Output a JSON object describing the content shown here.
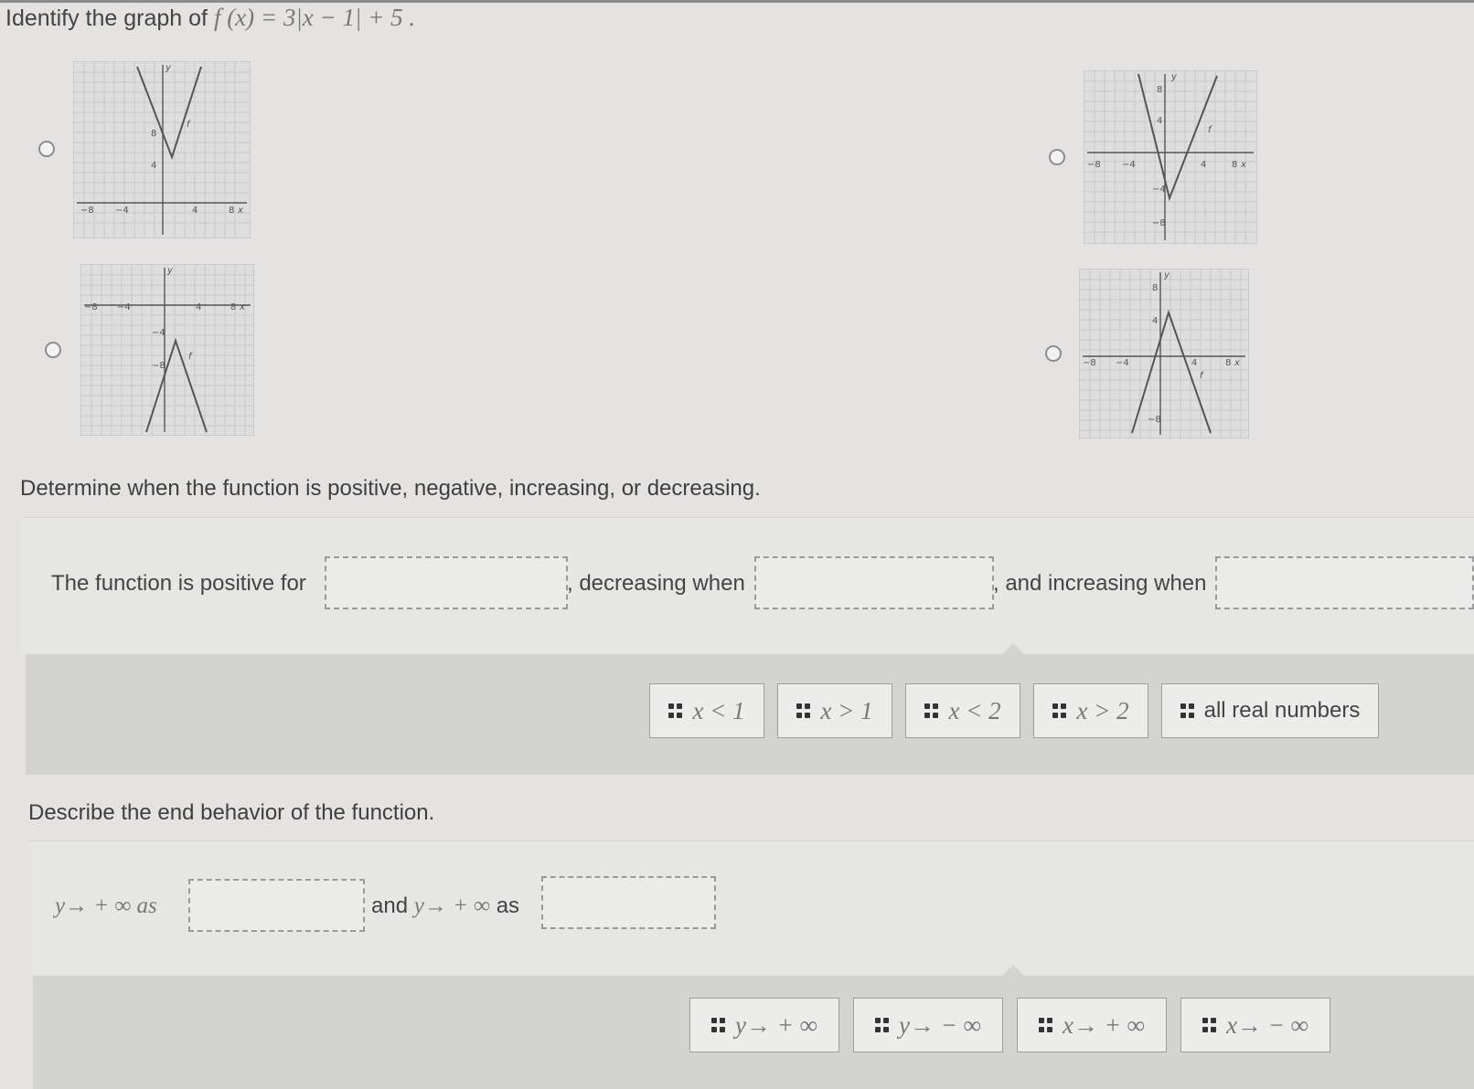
{
  "question": {
    "prefix": "Identify the graph of",
    "formula": "f (x) = 3|x − 1| + 5 ."
  },
  "graphs": [
    {
      "x_ticks": [
        "−8",
        "−4",
        "4",
        "8"
      ],
      "y_ticks": [
        "8",
        "4"
      ],
      "axis_x": "x",
      "axis_y": "y",
      "curve": "f"
    },
    {
      "x_ticks": [
        "−8",
        "−4",
        "4",
        "8"
      ],
      "y_ticks": [
        "8",
        "4",
        "−4",
        "−8"
      ],
      "axis_x": "x",
      "axis_y": "y",
      "curve": "f"
    },
    {
      "x_ticks": [
        "−8",
        "−4",
        "4",
        "8"
      ],
      "y_ticks": [
        "−4",
        "−8"
      ],
      "axis_x": "x",
      "axis_y": "y",
      "curve": "f"
    },
    {
      "x_ticks": [
        "−8",
        "−4",
        "4",
        "8"
      ],
      "y_ticks": [
        "8",
        "4",
        "−8"
      ],
      "axis_x": "x",
      "axis_y": "y",
      "curve": "f"
    }
  ],
  "part2": {
    "title": "Determine when the function is positive, negative, increasing, or decreasing.",
    "s1": "The function is positive for",
    "s2": ", decreasing when",
    "s3": ", and increasing when",
    "choices": [
      "x < 1",
      "x > 1",
      "x < 2",
      "x > 2",
      "all real numbers"
    ]
  },
  "part3": {
    "title": "Describe the end behavior of the function.",
    "s1": "y→ + ∞ as",
    "s2a": "and",
    "s2b": "y→ + ∞",
    "s2c": "as",
    "choices": [
      "y→ + ∞",
      "y→ − ∞",
      "x→ + ∞",
      "x→ − ∞"
    ]
  }
}
